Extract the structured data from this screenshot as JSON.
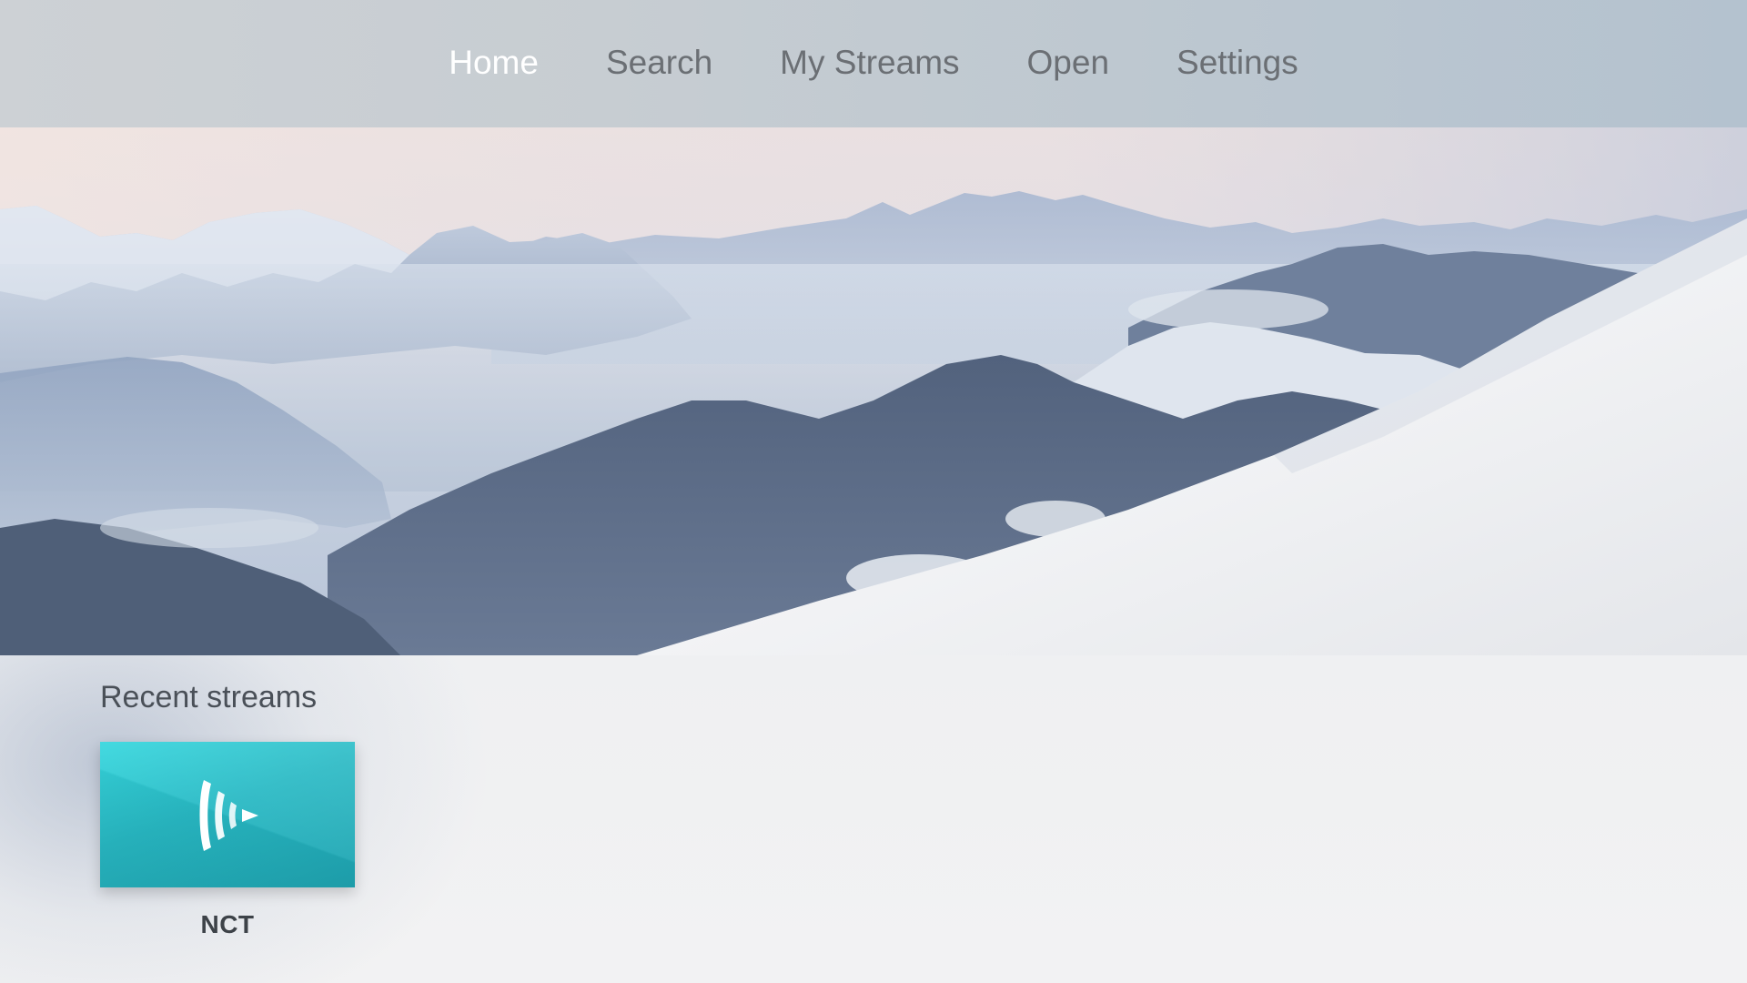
{
  "nav": {
    "items": [
      {
        "label": "Home",
        "active": true
      },
      {
        "label": "Search",
        "active": false
      },
      {
        "label": "My Streams",
        "active": false
      },
      {
        "label": "Open",
        "active": false
      },
      {
        "label": "Settings",
        "active": false
      }
    ]
  },
  "hero": {
    "image": "snowy-mountain-landscape"
  },
  "recent": {
    "title": "Recent streams",
    "items": [
      {
        "label": "NCT",
        "icon": "stream-play-icon",
        "color": "#2bbcc6"
      }
    ]
  },
  "colors": {
    "nav_active": "#ffffff",
    "nav_inactive": "#6b6f74",
    "tile_accent": "#2bbcc6"
  }
}
